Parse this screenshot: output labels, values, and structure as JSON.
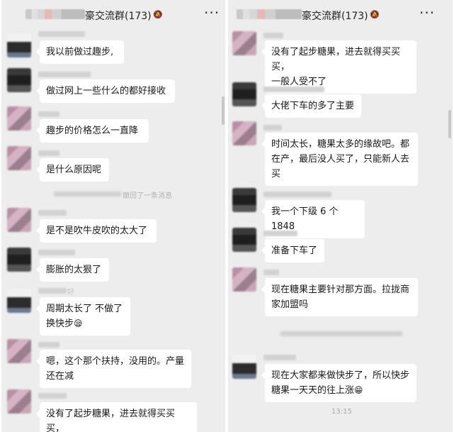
{
  "left_panel": {
    "header": {
      "title": "豪交流群(173)",
      "mute_icon": "mute-icon",
      "more": "···"
    },
    "messages": [
      {
        "text": "我以前做过趣步,"
      },
      {
        "text": "做过网上一些什么的都好接收"
      },
      {
        "text": "趣步的价格怎么一直降"
      },
      {
        "text": "是什么原因呢"
      },
      {
        "text": "是不是吹牛皮吹的太大了"
      },
      {
        "text": "膨胀的太狠了"
      },
      {
        "text": "周期太长了 不做了\n换快步"
      },
      {
        "text": "嗯，这个那个扶持，没用的。产量\n还在减"
      },
      {
        "text": "没有了起步糖果，进去就得买买买，"
      }
    ],
    "system_notice": "撤回了一条消息",
    "nick_suffix": "好"
  },
  "right_panel": {
    "header": {
      "title": "豪交流群(173)",
      "mute_icon": "mute-icon",
      "more": "···"
    },
    "messages": [
      {
        "text": "没有了起步糖果，进去就得买买买，\n一般人受不了"
      },
      {
        "text": "大佬下车的多了主要"
      },
      {
        "text": "时间太长，糖果太多的缘故吧。都\n在产，最后没人买了，只能新人去\n买"
      },
      {
        "text": "我一个下级 6 个 1848"
      },
      {
        "text": "准备下车了"
      },
      {
        "text": "现在糖果主要针对那方面。拉拢商\n家加盟吗"
      },
      {
        "text": "现在大家都来做快步了，所以快步\n糖果一天天的往上涨"
      }
    ],
    "timestamp": "13:15"
  },
  "emoji": {
    "yawn": "😪",
    "laugh": "😁"
  }
}
